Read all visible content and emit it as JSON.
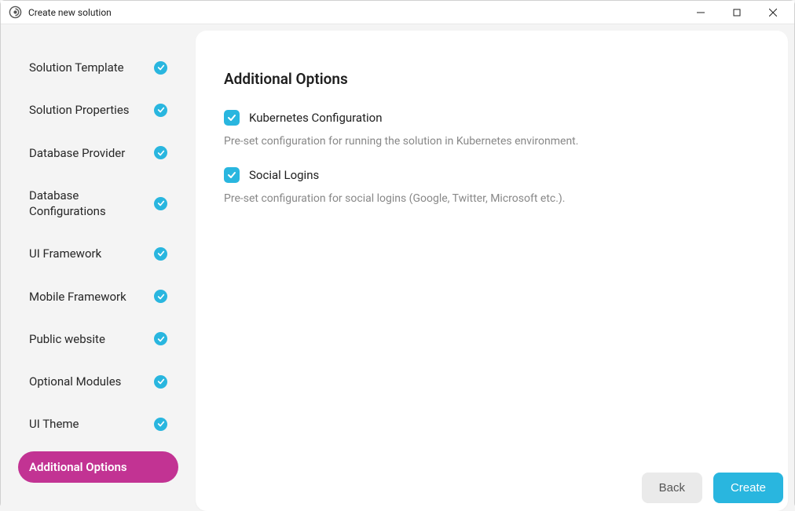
{
  "window": {
    "title": "Create new solution"
  },
  "sidebar": {
    "items": [
      {
        "label": "Solution Template",
        "completed": true,
        "active": false
      },
      {
        "label": "Solution Properties",
        "completed": true,
        "active": false
      },
      {
        "label": "Database Provider",
        "completed": true,
        "active": false
      },
      {
        "label": "Database Configurations",
        "completed": true,
        "active": false
      },
      {
        "label": "UI Framework",
        "completed": true,
        "active": false
      },
      {
        "label": "Mobile Framework",
        "completed": true,
        "active": false
      },
      {
        "label": "Public website",
        "completed": true,
        "active": false
      },
      {
        "label": "Optional Modules",
        "completed": true,
        "active": false
      },
      {
        "label": "UI Theme",
        "completed": true,
        "active": false
      },
      {
        "label": "Additional Options",
        "completed": false,
        "active": true
      }
    ]
  },
  "main": {
    "title": "Additional Options",
    "options": [
      {
        "label": "Kubernetes Configuration",
        "description": "Pre-set configuration for running the solution in Kubernetes environment.",
        "checked": true
      },
      {
        "label": "Social Logins",
        "description": "Pre-set configuration for social logins (Google, Twitter, Microsoft etc.).",
        "checked": true
      }
    ]
  },
  "footer": {
    "back_label": "Back",
    "create_label": "Create"
  },
  "colors": {
    "accent": "#29b6df",
    "active_nav": "#c23393"
  }
}
